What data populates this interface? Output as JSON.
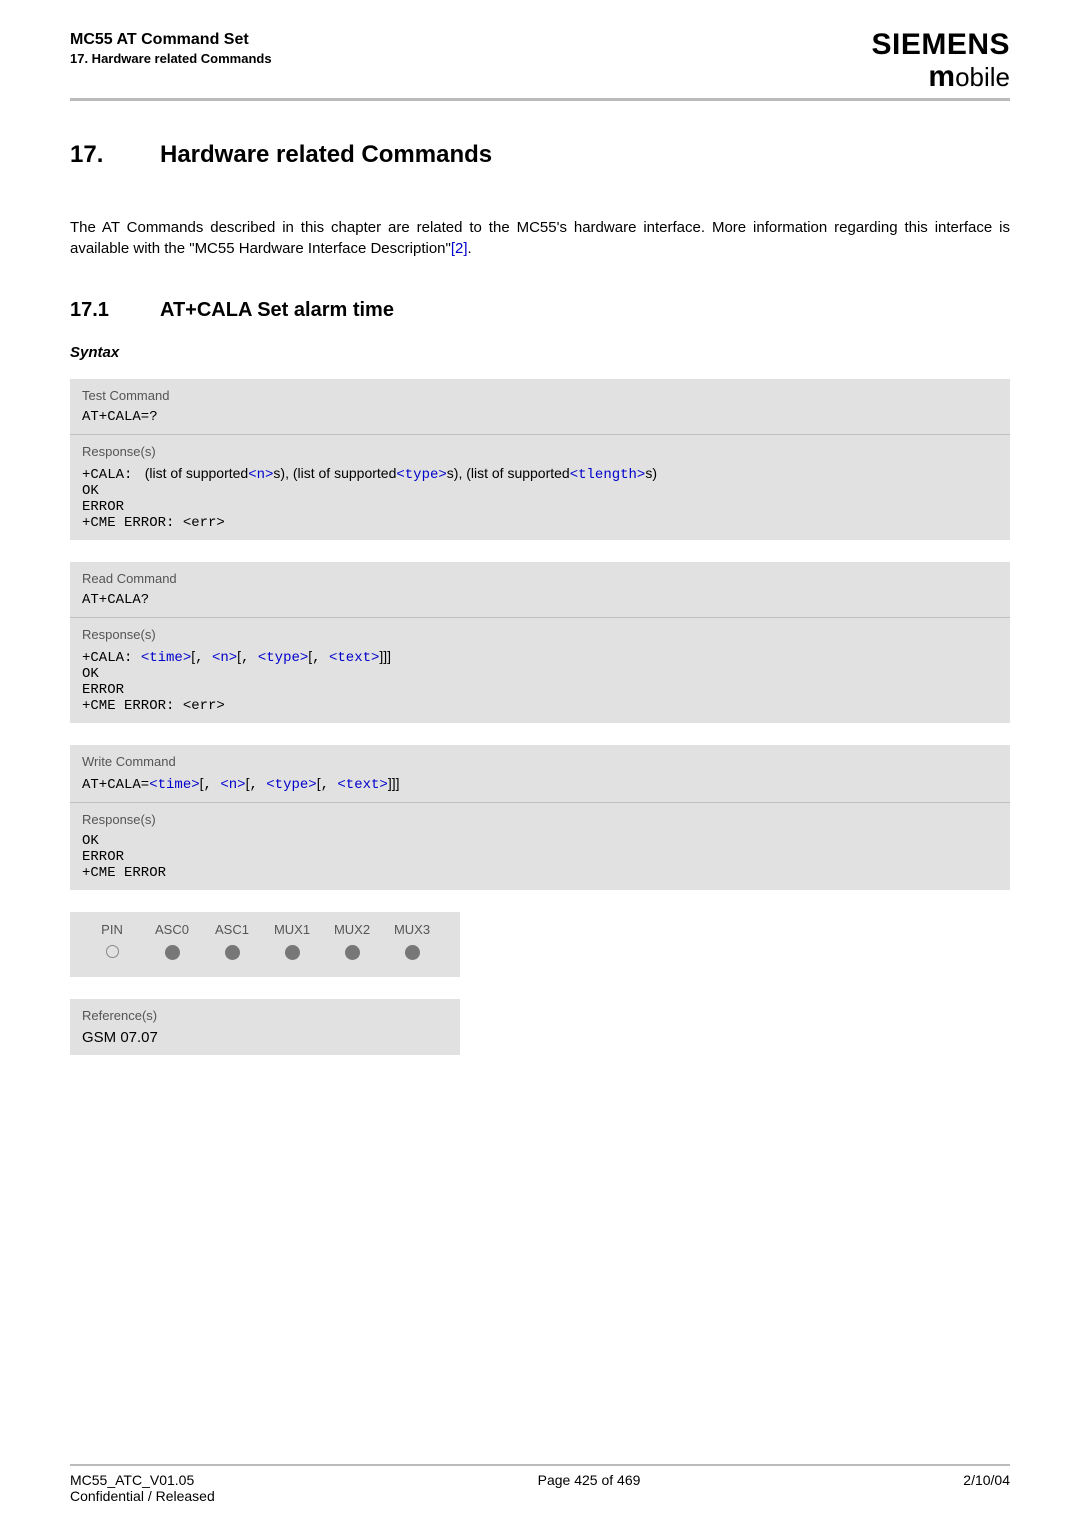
{
  "header": {
    "title": "MC55 AT Command Set",
    "sub": "17. Hardware related Commands",
    "brand_main": "SIEMENS",
    "brand_sub_m": "m",
    "brand_sub_rest": "obile"
  },
  "chapter": {
    "num": "17.",
    "title": "Hardware related Commands"
  },
  "intro": {
    "text1": "The AT Commands described in this chapter are related to the MC55's hardware interface. More information regarding this interface is available with the \"MC55 Hardware Interface Description\"",
    "link": "[2]",
    "text2": "."
  },
  "section": {
    "num": "17.1",
    "title": "AT+CALA   Set alarm time"
  },
  "syntax_heading": "Syntax",
  "test_block": {
    "heading": "Test Command",
    "cmd": "AT+CALA=?",
    "resp_heading": "Response(s)",
    "line1_a": "+CALA: ",
    "line1_b": " (list of supported",
    "param_n": "<n>",
    "line1_c": "s), (list of supported",
    "param_type": "<type>",
    "line1_d": "s), (list of supported",
    "param_tlength": "<tlength>",
    "line1_e": "s)",
    "ok": "OK",
    "error": "ERROR",
    "cme": "+CME ERROR: <err>"
  },
  "read_block": {
    "heading": "Read Command",
    "cmd": "AT+CALA?",
    "resp_heading": "Response(s)",
    "pre": "+CALA: ",
    "p_time": "<time>",
    "b1": "[",
    "c1": ", ",
    "p_n": "<n>",
    "b2": "[",
    "c2": ", ",
    "p_type": "<type>",
    "b3": "[",
    "c3": ", ",
    "p_text": "<text>",
    "b4": "]]]",
    "ok": "OK",
    "error": "ERROR",
    "cme": "+CME ERROR: <err>"
  },
  "write_block": {
    "heading": "Write Command",
    "cmd_pre": "AT+CALA=",
    "p_time": "<time>",
    "b1": "[",
    "c1": ", ",
    "p_n": "<n>",
    "b2": "[",
    "c2": ", ",
    "p_type": "<type>",
    "b3": "[",
    "c3": ", ",
    "p_text": "<text>",
    "b4": "]]]",
    "resp_heading": "Response(s)",
    "ok": "OK",
    "error": "ERROR",
    "cme": "+CME ERROR"
  },
  "pin_table": {
    "headers": [
      "PIN",
      "ASC0",
      "ASC1",
      "MUX1",
      "MUX2",
      "MUX3"
    ],
    "values": [
      "empty",
      "filled",
      "filled",
      "filled",
      "filled",
      "filled"
    ]
  },
  "ref_block": {
    "heading": "Reference(s)",
    "value": "GSM 07.07"
  },
  "footer": {
    "left1": "MC55_ATC_V01.05",
    "left2": "Confidential / Released",
    "center": "Page 425 of 469",
    "right": "2/10/04"
  }
}
